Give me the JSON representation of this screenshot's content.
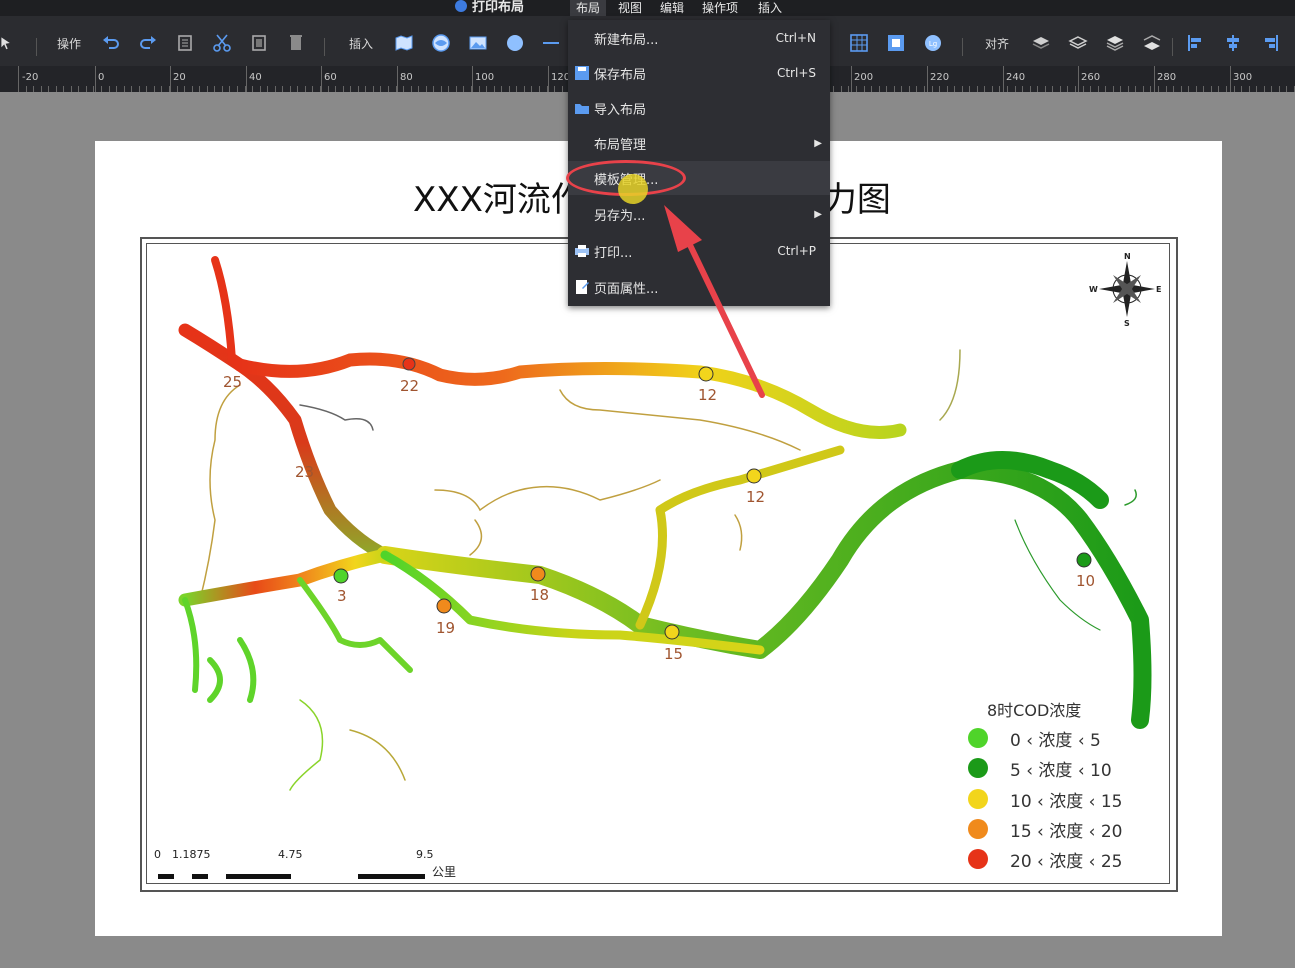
{
  "window": {
    "title": "打印布局"
  },
  "menubar": {
    "items": [
      "布局",
      "视图",
      "编辑",
      "操作项",
      "插入"
    ]
  },
  "toolbar": {
    "operate_label": "操作",
    "insert_label": "插入",
    "align_label": "对齐"
  },
  "ruler": {
    "labels": [
      "-20",
      "0",
      "20",
      "40",
      "60",
      "80",
      "100",
      "120",
      "200",
      "220",
      "240",
      "260",
      "280",
      "300"
    ]
  },
  "map": {
    "title_left": "XXX河流作",
    "title_right": "力图",
    "sites": [
      {
        "label": "25",
        "value": 25
      },
      {
        "label": "22",
        "value": 22
      },
      {
        "label": "23",
        "value": 23
      },
      {
        "label": "12",
        "value": 12
      },
      {
        "label": "12",
        "value": 12
      },
      {
        "label": "3",
        "value": 3
      },
      {
        "label": "19",
        "value": 19
      },
      {
        "label": "18",
        "value": 18
      },
      {
        "label": "15",
        "value": 15
      },
      {
        "label": "10",
        "value": 10
      }
    ],
    "compass": {
      "n": "N",
      "s": "S",
      "e": "E",
      "w": "W"
    }
  },
  "legend": {
    "title": "8时COD浓度",
    "items": [
      {
        "label": "0 ‹ 浓度 ‹ 5",
        "color": "#4fd42a"
      },
      {
        "label": "5 ‹ 浓度 ‹ 10",
        "color": "#1b9a18"
      },
      {
        "label": "10 ‹ 浓度 ‹ 15",
        "color": "#f2d51c"
      },
      {
        "label": "15 ‹ 浓度 ‹ 20",
        "color": "#f08a1c"
      },
      {
        "label": "20 ‹ 浓度 ‹ 25",
        "color": "#e63318"
      }
    ]
  },
  "scalebar": {
    "labels": [
      "0",
      "1.1875",
      "4.75",
      "9.5"
    ],
    "unit": "公里"
  },
  "dropdown": {
    "items": [
      {
        "label": "新建布局...",
        "shortcut": "Ctrl+N"
      },
      {
        "label": "保存布局",
        "shortcut": "Ctrl+S"
      },
      {
        "label": "导入布局",
        "shortcut": ""
      },
      {
        "label": "布局管理",
        "shortcut": ""
      },
      {
        "label": "模板管理...",
        "shortcut": ""
      },
      {
        "label": "另存为...",
        "shortcut": ""
      },
      {
        "label": "打印...",
        "shortcut": "Ctrl+P"
      },
      {
        "label": "页面属性...",
        "shortcut": ""
      }
    ]
  },
  "colors": {
    "highlight": "#e8424a",
    "accent": "#3d7be0"
  }
}
